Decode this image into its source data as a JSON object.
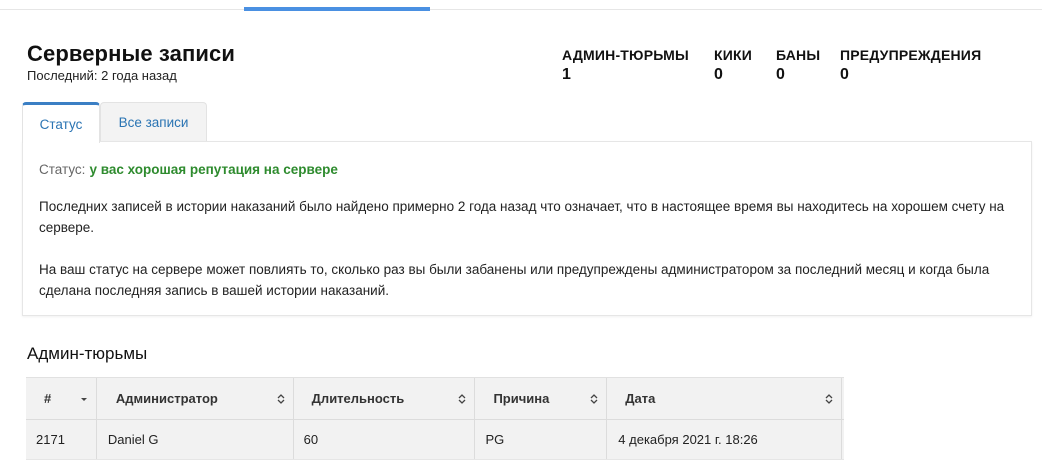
{
  "header": {
    "title": "Серверные записи",
    "subtitle": "Последний: 2 года назад"
  },
  "stats": [
    {
      "label": "АДМИН-ТЮРЬМЫ",
      "value": "1"
    },
    {
      "label": "КИКИ",
      "value": "0"
    },
    {
      "label": "БАНЫ",
      "value": "0"
    },
    {
      "label": "ПРЕДУПРЕЖДЕНИЯ",
      "value": "0"
    }
  ],
  "tabs": [
    {
      "label": "Статус",
      "active": true
    },
    {
      "label": "Все записи",
      "active": false
    }
  ],
  "status_panel": {
    "status_prefix": "Статус:",
    "status_text": "у вас хорошая репутация на сервере",
    "paragraph1": "Последних записей в истории наказаний было найдено примерно 2 года назад что означает, что в настоящее время вы находитесь на хорошем счету на сервере.",
    "paragraph2": "На ваш статус на сервере может повлиять то, сколько раз вы были забанены или предупреждены администратором за последний месяц и когда была сделана последняя запись в вашей истории наказаний."
  },
  "jails_section": {
    "title": "Админ-тюрьмы",
    "columns": [
      "#",
      "Администратор",
      "Длительность",
      "Причина",
      "Дата"
    ],
    "rows": [
      [
        "2171",
        "Daniel G",
        "60",
        "PG",
        "4 декабря 2021 г. 18:26"
      ]
    ]
  },
  "colors": {
    "accent": "#4a90e2",
    "tab_link": "#2a74b3",
    "good_status": "#2e8b2e"
  }
}
